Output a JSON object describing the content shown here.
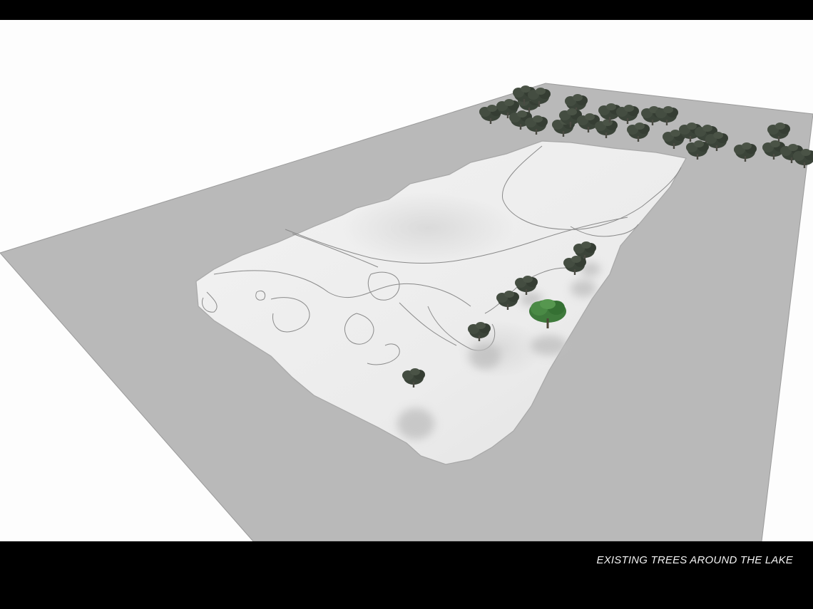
{
  "scene": {
    "caption": "EXISTING TREES AROUND THE LAKE",
    "colors": {
      "background": "#fdfdfd",
      "ground_plane": "#b9b9b9",
      "terrain": "#ececec",
      "contour_line": "#8a8a8a",
      "tree_dark": "#3b4439",
      "tree_highlight": "#3f7a3c",
      "frame_bars": "#000000"
    },
    "icons": [
      "tree-icon"
    ]
  }
}
